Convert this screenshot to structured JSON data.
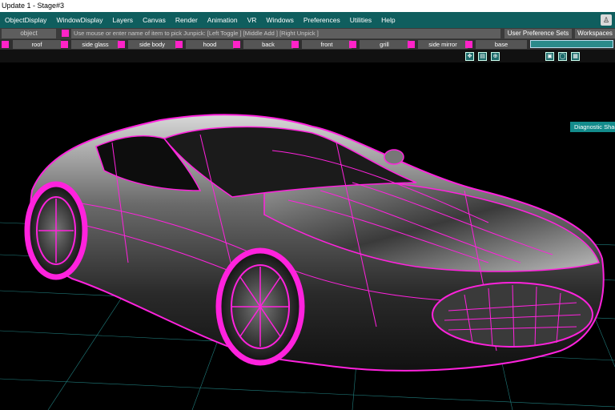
{
  "window": {
    "title": "Update 1  - Stage#3"
  },
  "menu": [
    "ObjectDisplay",
    "WindowDisplay",
    "Layers",
    "Canvas",
    "Render",
    "Animation",
    "VR",
    "Windows",
    "Preferences",
    "Utilities",
    "Help"
  ],
  "pick": {
    "object_field": "object",
    "hint": "Use mouse or enter name of item to pick Junpick: [Left Toggle ] [Middle Add ] [Right Unpick ]",
    "user_pref_label": "User Preference Sets",
    "workspaces_label": "Workspaces"
  },
  "layers": [
    "roof",
    "side glass",
    "side body",
    "hood",
    "back",
    "front",
    "grill",
    "side mirror",
    "base"
  ],
  "viewport": {
    "diagnostic_label": "Diagnostic Shading",
    "wire_color": "#ff22dd",
    "grid_color": "#2fb4b4"
  },
  "colors": {
    "menu_bg": "#0f5e5e",
    "layer_swatch": "#ff23c8",
    "teal_accent": "#138b8b"
  },
  "icons": [
    "user-icon",
    "camera-pan-icon",
    "camera-dolly-icon",
    "camera-zoom-icon",
    "fit-view-icon",
    "frame-icon",
    "grid-toggle-icon"
  ]
}
